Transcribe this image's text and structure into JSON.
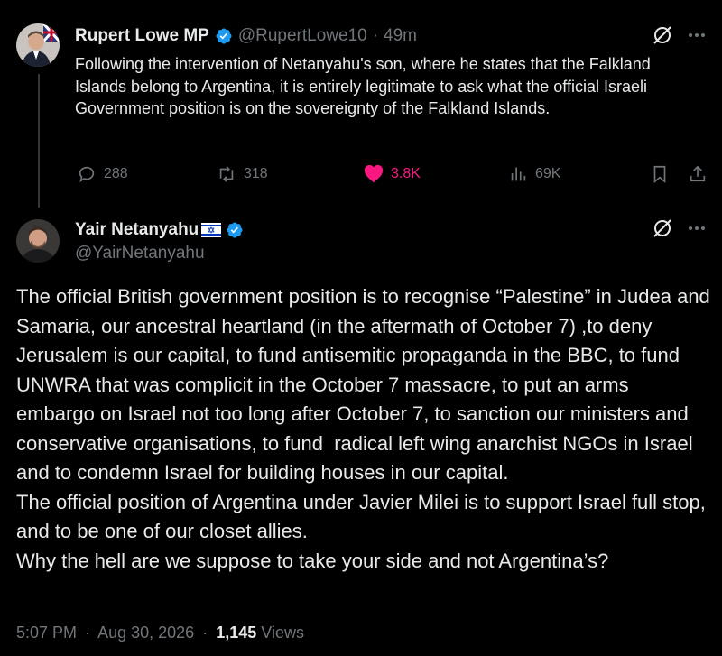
{
  "tweet1": {
    "author_name": "Rupert Lowe MP",
    "handle": "@RupertLowe10",
    "separator": "·",
    "time_ago": "49m",
    "text": "Following the intervention of Netanyahu's son, where he states that the Falkland Islands belong to Argentina, it is entirely legitimate to ask what the official Israeli Government position is on the sovereignty of the Falkland Islands.",
    "replies": "288",
    "reposts": "318",
    "likes": "3.8K",
    "views": "69K",
    "more_icon": "ellipsis-icon",
    "grok_icon": "grok-icon",
    "colors": {
      "like": "#f91880",
      "verified": "#1d9bf0"
    }
  },
  "tweet2": {
    "author_name": "Yair Netanyahu",
    "flag": "israel-flag-icon",
    "handle": "@YairNetanyahu",
    "text": "The official British government position is to recognise “Palestine” in Judea and Samaria, our ancestral heartland (in the aftermath of October 7) ,to deny Jerusalem is our capital, to fund antisemitic propaganda in the BBC, to fund UNWRA that was complicit in the October 7 massacre, to put an arms embargo on Israel not too long after October 7, to sanction our ministers and conservative organisations, to fund  radical left wing anarchist NGOs in Israel and to condemn Israel for building houses in our capital.\nThe official position of Argentina under Javier Milei is to support Israel full stop, and to be one of our closet allies.\nWhy the hell are we suppose to take your side and not Argentina’s?",
    "time": "5:07 PM",
    "dot": "·",
    "date": "Aug 30, 2026",
    "views_count": "1,145",
    "views_label": "Views"
  }
}
